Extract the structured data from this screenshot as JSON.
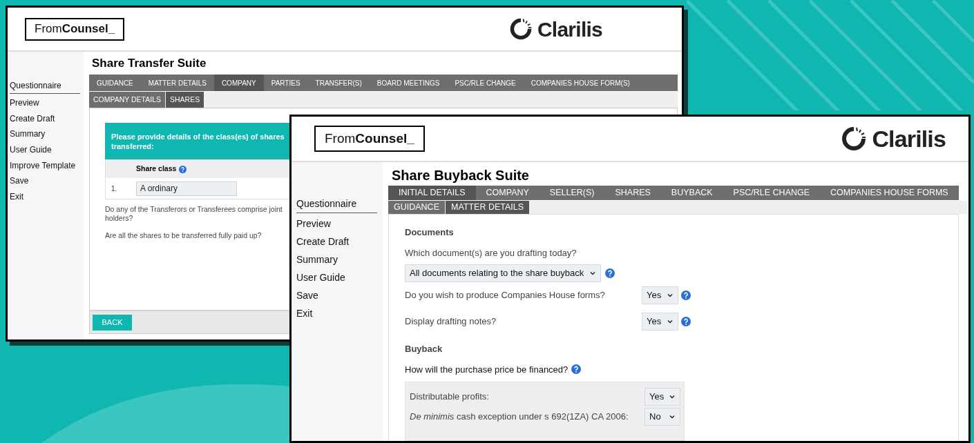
{
  "back_window": {
    "logo_text": "From",
    "logo_bold": "Counsel_",
    "brand": "Clarilis",
    "title": "Share Transfer Suite",
    "sidebar": [
      {
        "label": "Questionnaire",
        "selected": true
      },
      {
        "label": "Preview",
        "selected": false
      },
      {
        "label": "Create Draft",
        "selected": false
      },
      {
        "label": "Summary",
        "selected": false
      },
      {
        "label": "User Guide",
        "selected": false
      },
      {
        "label": "Improve Template",
        "selected": false
      },
      {
        "label": "Save",
        "selected": false
      },
      {
        "label": "Exit",
        "selected": false
      }
    ],
    "tabs": [
      {
        "label": "GUIDANCE",
        "selected": false
      },
      {
        "label": "MATTER DETAILS",
        "selected": false
      },
      {
        "label": "COMPANY",
        "selected": true
      },
      {
        "label": "PARTIES",
        "selected": false
      },
      {
        "label": "TRANSFER(S)",
        "selected": false
      },
      {
        "label": "BOARD MEETINGS",
        "selected": false
      },
      {
        "label": "PSC/RLE CHANGE",
        "selected": false
      },
      {
        "label": "COMPANIES HOUSE FORM(S)",
        "selected": false
      }
    ],
    "subtabs": [
      {
        "label": "COMPANY DETAILS",
        "selected": false
      },
      {
        "label": "SHARES",
        "selected": true
      }
    ],
    "panel_title": "Please provide details of the class(es) of shares transferred:",
    "column_header": "Share class",
    "rows": [
      {
        "number": "1.",
        "value": "A ordinary"
      }
    ],
    "questions": [
      "Do any of the Transferors or Transferees comprise joint holders?",
      "Are all the shares to be transferred fully paid up?"
    ],
    "back_button": "BACK"
  },
  "front_window": {
    "logo_text": "From",
    "logo_bold": "Counsel_",
    "brand": "Clarilis",
    "title": "Share Buyback Suite",
    "sidebar": [
      {
        "label": "Questionnaire",
        "selected": true
      },
      {
        "label": "Preview",
        "selected": false
      },
      {
        "label": "Create Draft",
        "selected": false
      },
      {
        "label": "Summary",
        "selected": false
      },
      {
        "label": "User Guide",
        "selected": false
      },
      {
        "label": "Save",
        "selected": false
      },
      {
        "label": "Exit",
        "selected": false
      }
    ],
    "tabs": [
      {
        "label": "INITIAL DETAILS",
        "selected": true
      },
      {
        "label": "COMPANY",
        "selected": false
      },
      {
        "label": "SELLER(S)",
        "selected": false
      },
      {
        "label": "SHARES",
        "selected": false
      },
      {
        "label": "BUYBACK",
        "selected": false
      },
      {
        "label": "PSC/RLE CHANGE",
        "selected": false
      },
      {
        "label": "COMPANIES HOUSE FORMS",
        "selected": false
      }
    ],
    "subtabs": [
      {
        "label": "GUIDANCE",
        "selected": false
      },
      {
        "label": "MATTER DETAILS",
        "selected": true
      }
    ],
    "sections": [
      {
        "heading": "Documents",
        "questions": [
          {
            "kind": "stacked",
            "label": "Which document(s) are you drafting today?",
            "value": "All documents relating to the share buyback"
          },
          {
            "kind": "inline",
            "label": "Do you wish to produce Companies House forms?",
            "value": "Yes"
          },
          {
            "kind": "inline",
            "label": "Display drafting notes?",
            "value": "Yes"
          }
        ]
      },
      {
        "heading": "Buyback",
        "questions": [
          {
            "kind": "group",
            "label": "How will the purchase price be financed?",
            "rows": [
              {
                "label": "Distributable profits:",
                "value": "Yes"
              },
              {
                "label": "*De minimis* cash exception under s 692(1ZA) CA 2006:",
                "value": "No"
              }
            ]
          }
        ]
      }
    ]
  }
}
